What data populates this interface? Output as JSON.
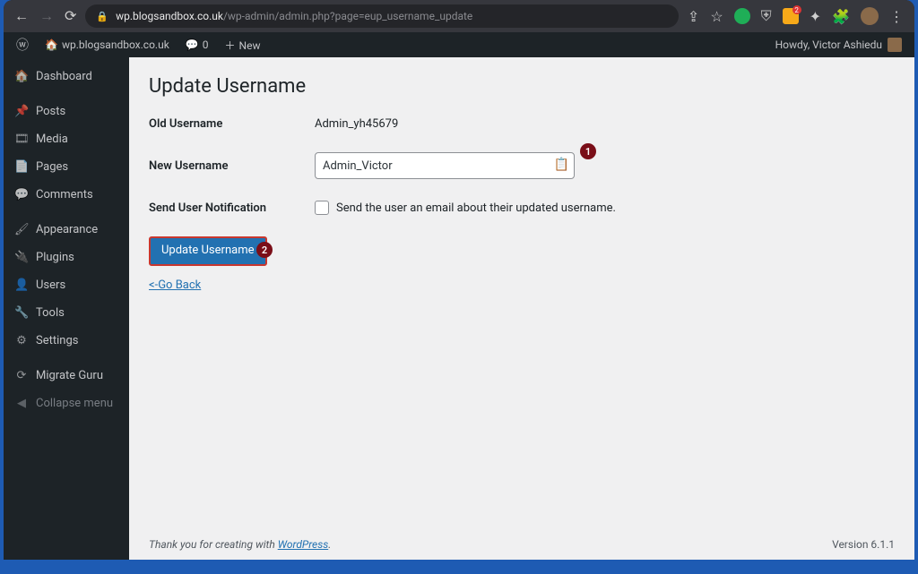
{
  "browser": {
    "url_host": "wp.blogsandbox.co.uk",
    "url_path": "/wp-admin/admin.php?page=eup_username_update"
  },
  "adminbar": {
    "site_name": "wp.blogsandbox.co.uk",
    "comments": "0",
    "new_label": "New",
    "howdy": "Howdy, Victor Ashiedu"
  },
  "sidebar": {
    "items": [
      {
        "icon": "🏠",
        "label": "Dashboard",
        "name": "dashboard"
      },
      {
        "icon": "📌",
        "label": "Posts",
        "name": "posts"
      },
      {
        "icon": "🎞",
        "label": "Media",
        "name": "media"
      },
      {
        "icon": "📄",
        "label": "Pages",
        "name": "pages"
      },
      {
        "icon": "💬",
        "label": "Comments",
        "name": "comments"
      },
      {
        "icon": "🖌",
        "label": "Appearance",
        "name": "appearance"
      },
      {
        "icon": "🔌",
        "label": "Plugins",
        "name": "plugins"
      },
      {
        "icon": "👤",
        "label": "Users",
        "name": "users"
      },
      {
        "icon": "🔧",
        "label": "Tools",
        "name": "tools"
      },
      {
        "icon": "⚙",
        "label": "Settings",
        "name": "settings"
      },
      {
        "icon": "⟳",
        "label": "Migrate Guru",
        "name": "migrate-guru"
      }
    ],
    "collapse": "Collapse menu"
  },
  "page": {
    "title": "Update Username",
    "old_label": "Old Username",
    "old_value": "Admin_yh45679",
    "new_label": "New Username",
    "new_value": "Admin_Victor",
    "notify_label": "Send User Notification",
    "notify_text": "Send the user an email about their updated username.",
    "submit_label": "Update Username",
    "back_label": "<-Go Back"
  },
  "badges": {
    "one": "1",
    "two": "2"
  },
  "footer": {
    "text": "Thank you for creating with ",
    "link": "WordPress",
    "link_tail": ".",
    "version": "Version 6.1.1"
  }
}
